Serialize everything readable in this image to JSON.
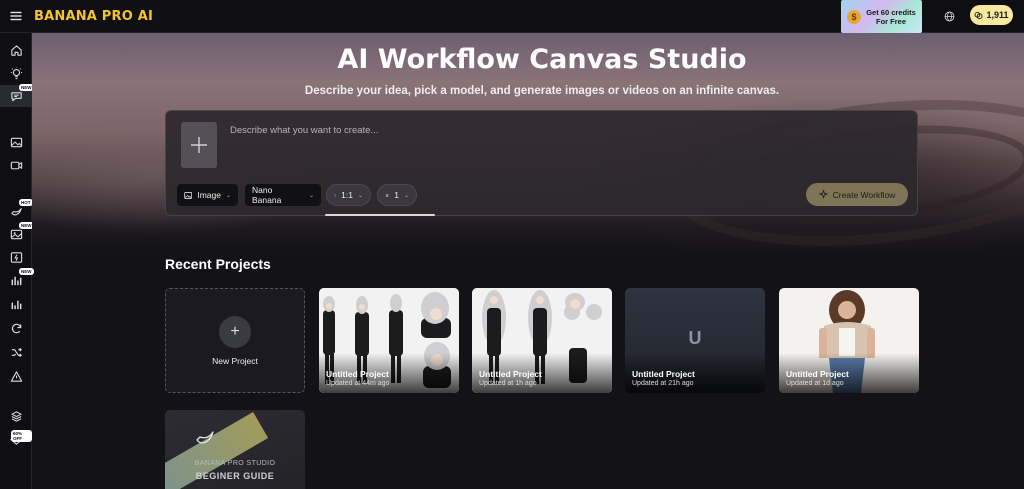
{
  "header": {
    "brand": "BANANA PRO AI",
    "promo_text": "Get 60 credits For Free",
    "promo_coin": "$",
    "credits": "1,911"
  },
  "sidebar": {
    "items": [
      {
        "icon": "home-icon",
        "badge": ""
      },
      {
        "icon": "lightbulb-icon",
        "badge": ""
      },
      {
        "icon": "chat-icon",
        "badge": "NEW"
      },
      {
        "icon": "image-icon",
        "badge": ""
      },
      {
        "icon": "video-icon",
        "badge": ""
      },
      {
        "icon": "banana-icon",
        "badge": "HOT"
      },
      {
        "icon": "image-edit-icon",
        "badge": "NEW"
      },
      {
        "icon": "flash-image-icon",
        "badge": ""
      },
      {
        "icon": "chart-icon",
        "badge": "NEW"
      },
      {
        "icon": "bar-chart-icon",
        "badge": ""
      },
      {
        "icon": "refresh-icon",
        "badge": ""
      },
      {
        "icon": "shuffle-icon",
        "badge": ""
      },
      {
        "icon": "triangle-icon",
        "badge": ""
      },
      {
        "icon": "layers-icon",
        "badge": ""
      },
      {
        "icon": "diamond-icon",
        "badge": "60% OFF"
      }
    ]
  },
  "hero": {
    "title": "AI Workflow Canvas Studio",
    "subtitle": "Describe your idea, pick a model, and generate images or videos on an infinite canvas.",
    "prompt_placeholder": "Describe what you want to create...",
    "type_label": "Image",
    "model_label": "Nano Banana",
    "ratio_label": "1:1",
    "count_label": "1",
    "create_label": "Create Workflow"
  },
  "recent": {
    "title": "Recent Projects",
    "new_label": "New Project",
    "projects": [
      {
        "title": "Untitled Project",
        "time": "Updated at 44m ago"
      },
      {
        "title": "Untitled Project",
        "time": "Updated at 1h ago"
      },
      {
        "title": "Untitled Project",
        "time": "Updated at 21h ago",
        "letter": "U"
      },
      {
        "title": "Untitled Project",
        "time": "Updated at 1d ago"
      }
    ]
  },
  "guide": {
    "small": "BANANA PRO STUDIO",
    "big": "BEGINER GUIDE"
  },
  "colors": {
    "brand": "#f5c528",
    "credits_bg": "#f7e9a0",
    "create_button": "#807458"
  }
}
